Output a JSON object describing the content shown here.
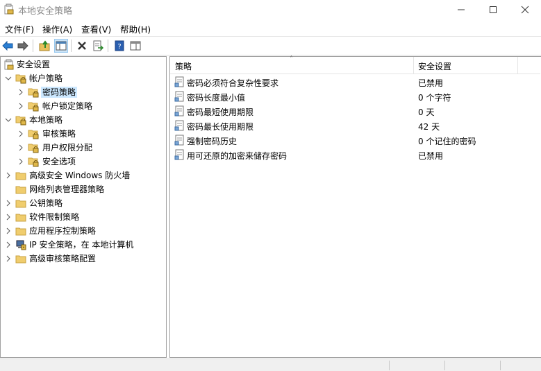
{
  "window": {
    "title": "本地安全策略"
  },
  "menubar": [
    {
      "label": "文件(F)"
    },
    {
      "label": "操作(A)"
    },
    {
      "label": "查看(V)"
    },
    {
      "label": "帮助(H)"
    }
  ],
  "toolbar": {
    "icons": [
      "back-arrow-icon",
      "forward-arrow-icon",
      "up-folder-icon",
      "show-hide-tree-icon",
      "delete-icon",
      "export-list-icon",
      "help-icon",
      "properties-view-icon"
    ],
    "pressed": "show-hide-tree-icon"
  },
  "tree": {
    "root": {
      "label": "安全设置"
    },
    "items": [
      {
        "label": "帐户策略",
        "level": 1,
        "state": "expanded",
        "icon": "folder-lock-icon"
      },
      {
        "label": "密码策略",
        "level": 2,
        "state": "collapsed",
        "icon": "folder-lock-icon",
        "selected": true
      },
      {
        "label": "帐户锁定策略",
        "level": 2,
        "state": "collapsed",
        "icon": "folder-lock-icon"
      },
      {
        "label": "本地策略",
        "level": 1,
        "state": "expanded",
        "icon": "folder-lock-icon"
      },
      {
        "label": "审核策略",
        "level": 2,
        "state": "collapsed",
        "icon": "folder-lock-icon"
      },
      {
        "label": "用户权限分配",
        "level": 2,
        "state": "collapsed",
        "icon": "folder-lock-icon"
      },
      {
        "label": "安全选项",
        "level": 2,
        "state": "collapsed",
        "icon": "folder-lock-icon"
      },
      {
        "label": "高级安全 Windows 防火墙",
        "level": 1,
        "state": "collapsed",
        "icon": "folder-icon"
      },
      {
        "label": "网络列表管理器策略",
        "level": 1,
        "state": "none",
        "icon": "folder-icon"
      },
      {
        "label": "公钥策略",
        "level": 1,
        "state": "collapsed",
        "icon": "folder-icon"
      },
      {
        "label": "软件限制策略",
        "level": 1,
        "state": "collapsed",
        "icon": "folder-icon"
      },
      {
        "label": "应用程序控制策略",
        "level": 1,
        "state": "collapsed",
        "icon": "folder-icon"
      },
      {
        "label": "IP 安全策略，在 本地计算机",
        "level": 1,
        "state": "collapsed",
        "icon": "ip-security-icon"
      },
      {
        "label": "高级审核策略配置",
        "level": 1,
        "state": "collapsed",
        "icon": "folder-icon"
      }
    ]
  },
  "list": {
    "columns": {
      "policy": "策略",
      "setting": "安全设置"
    },
    "rows": [
      {
        "name": "密码必须符合复杂性要求",
        "value": "已禁用"
      },
      {
        "name": "密码长度最小值",
        "value": "0 个字符"
      },
      {
        "name": "密码最短使用期限",
        "value": "0 天"
      },
      {
        "name": "密码最长使用期限",
        "value": "42 天"
      },
      {
        "name": "强制密码历史",
        "value": "0 个记住的密码"
      },
      {
        "name": "用可还原的加密来储存密码",
        "value": "已禁用"
      }
    ]
  },
  "colors": {
    "selection": "#cce8ff",
    "folder": "#e8c05a",
    "accent": "#1e73be"
  }
}
